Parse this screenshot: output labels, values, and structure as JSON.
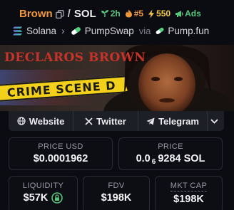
{
  "header": {
    "token_symbol": "Brown",
    "separator": "/",
    "quote_symbol": "SOL",
    "age": "2h",
    "rank": "#5",
    "boosts": "550",
    "ads_label": "Ads"
  },
  "route": {
    "chain": "Solana",
    "dex": "PumpSwap",
    "via": "via",
    "launchpad": "Pump.fun"
  },
  "banner": {
    "headline": "DECLAROS BROWN",
    "tape_text": "CRIME SCENE D"
  },
  "links": {
    "website": "Website",
    "twitter": "Twitter",
    "telegram": "Telegram"
  },
  "stats": {
    "price_usd_label": "PRICE USD",
    "price_usd_value": "$0.0001962",
    "price_label": "PRICE",
    "price_sol_lead": "0.0",
    "price_sol_zeros": "6",
    "price_sol_tail": "9284 SOL",
    "liquidity_label": "LIQUIDITY",
    "liquidity_value": "$57K",
    "fdv_label": "FDV",
    "fdv_value": "$198K",
    "mktcap_label": "MKT CAP",
    "mktcap_value": "$198K"
  },
  "colors": {
    "accent_orange": "#f0973c",
    "accent_green": "#59c57a",
    "accent_yellow": "#f2c94c",
    "banner_red": "#c5342a",
    "tape_yellow": "#f3d11a"
  }
}
